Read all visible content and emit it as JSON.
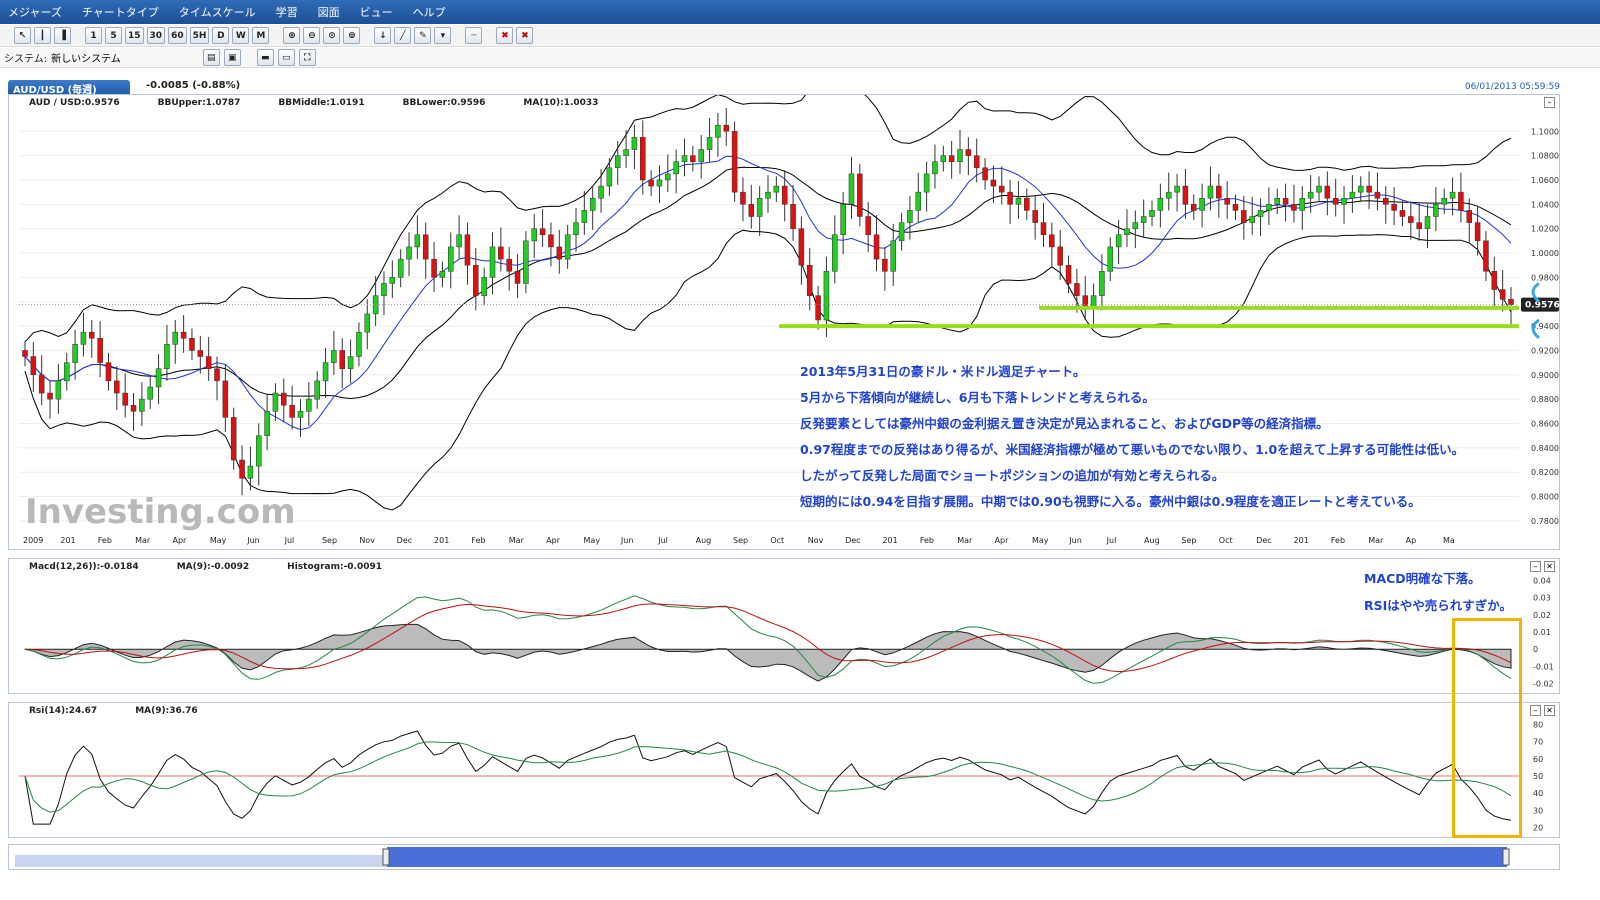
{
  "menu": {
    "items": [
      "メジャーズ",
      "チャートタイプ",
      "タイムスケール",
      "学習",
      "図面",
      "ビュー",
      "ヘルプ"
    ]
  },
  "toolbar": {
    "timeframes": [
      "1",
      "5",
      "15",
      "30",
      "60",
      "5H",
      "D",
      "W",
      "M"
    ]
  },
  "system": {
    "label": "システム:",
    "value": "新しいシステム"
  },
  "symbol": {
    "name": "AUD/USD (毎週)",
    "change": "-0.0085 (-0.88%)",
    "datetime": "06/01/2013 05:59:59"
  },
  "main_legend": {
    "price": "AUD / USD:0.9576",
    "bb_upper": "BBUpper:1.0787",
    "bb_middle": "BBMiddle:1.0191",
    "bb_lower": "BBLower:0.9596",
    "ma": "MA(10):1.0033"
  },
  "macd_legend": {
    "macd": "Macd(12,26)):-0.0184",
    "ma": "MA(9):-0.0092",
    "hist": "Histogram:-0.0091"
  },
  "rsi_legend": {
    "rsi": "Rsi(14):24.67",
    "ma": "MA(9):36.76"
  },
  "last_price": "0.9576",
  "watermark": "Investing.com",
  "annotations": {
    "main": [
      "2013年5月31日の豪ドル・米ドル週足チャート。",
      "5月から下落傾向が継続し、6月も下落トレンドと考えられる。",
      "反発要素としては豪州中銀の金利据え置き決定が見込まれること、およびGDP等の経済指標。",
      "0.97程度までの反発はあり得るが、米国経済指標が極めて悪いものでない限り、1.0を超えて上昇する可能性は低い。",
      "したがって反発した局面でショートポジションの追加が有効と考えられる。",
      "短期的には0.94を目指す展開。中期では0.90も視野に入る。豪州中銀は0.9程度を適正レートと考えている。"
    ],
    "macd": "MACD明確な下落。",
    "rsi": "RSIはやや売られすぎか。"
  },
  "colors": {
    "bull": "#22cc22",
    "bear": "#dd1111",
    "band": "#000000",
    "ma": "#2233dd",
    "macd_line": "#228844",
    "signal_line": "#bb1111",
    "hist": "#999999",
    "annotation": "#2244cc",
    "support": "#99dd22",
    "highlight": "#f5b400"
  },
  "chart_data": [
    {
      "type": "line",
      "subtype": "candlestick",
      "title": "AUD/USD (毎週)",
      "x_tick_labels": [
        "2009",
        "201",
        "Feb",
        "Mar",
        "Apr",
        "May",
        "Jun",
        "Jul",
        "Sep",
        "Nov",
        "Dec",
        "201",
        "Feb",
        "Mar",
        "Apr",
        "May",
        "Jun",
        "Jul",
        "Aug",
        "Sep",
        "Oct",
        "Nov",
        "Dec",
        "201",
        "Feb",
        "Mar",
        "Apr",
        "May",
        "Jun",
        "Jul",
        "Aug",
        "Sep",
        "Oct",
        "Dec",
        "201",
        "Feb",
        "Mar",
        "Ap",
        "Ma"
      ],
      "y_ticks": [
        0.78,
        0.8,
        0.82,
        0.84,
        0.86,
        0.88,
        0.9,
        0.92,
        0.94,
        0.96,
        0.98,
        1.0,
        1.02,
        1.04,
        1.06,
        1.08,
        1.1
      ],
      "ylim": [
        0.775,
        1.115
      ],
      "close_series": [
        0.915,
        0.9,
        0.885,
        0.88,
        0.895,
        0.91,
        0.925,
        0.935,
        0.93,
        0.91,
        0.895,
        0.885,
        0.875,
        0.87,
        0.88,
        0.89,
        0.905,
        0.925,
        0.935,
        0.93,
        0.92,
        0.915,
        0.905,
        0.895,
        0.865,
        0.83,
        0.815,
        0.825,
        0.85,
        0.87,
        0.885,
        0.875,
        0.865,
        0.87,
        0.88,
        0.895,
        0.91,
        0.92,
        0.905,
        0.915,
        0.935,
        0.95,
        0.965,
        0.975,
        0.98,
        0.995,
        1.005,
        1.015,
        0.995,
        0.98,
        0.985,
        1.005,
        1.015,
        0.99,
        0.965,
        0.98,
        1.005,
        0.995,
        0.985,
        0.975,
        1.01,
        1.02,
        1.015,
        1.005,
        0.995,
        1.015,
        1.025,
        1.035,
        1.045,
        1.055,
        1.07,
        1.08,
        1.085,
        1.095,
        1.06,
        1.055,
        1.06,
        1.065,
        1.075,
        1.08,
        1.075,
        1.085,
        1.095,
        1.105,
        1.1,
        1.05,
        1.04,
        1.03,
        1.045,
        1.05,
        1.055,
        1.04,
        1.02,
        0.99,
        0.965,
        0.945,
        0.985,
        1.015,
        1.04,
        1.065,
        1.03,
        1.015,
        0.995,
        0.985,
        1.01,
        1.025,
        1.035,
        1.05,
        1.065,
        1.075,
        1.08,
        1.075,
        1.085,
        1.08,
        1.07,
        1.06,
        1.055,
        1.05,
        1.04,
        1.045,
        1.035,
        1.025,
        1.015,
        1.005,
        0.99,
        0.975,
        0.965,
        0.955,
        0.965,
        0.985,
        1.005,
        1.015,
        1.02,
        1.025,
        1.03,
        1.035,
        1.045,
        1.05,
        1.055,
        1.04,
        1.035,
        1.045,
        1.055,
        1.045,
        1.04,
        1.035,
        1.025,
        1.03,
        1.035,
        1.04,
        1.045,
        1.04,
        1.035,
        1.045,
        1.05,
        1.055,
        1.045,
        1.04,
        1.045,
        1.05,
        1.055,
        1.05,
        1.045,
        1.04,
        1.035,
        1.03,
        1.025,
        1.02,
        1.03,
        1.04,
        1.045,
        1.05,
        1.035,
        1.025,
        1.01,
        0.985,
        0.97,
        0.962,
        0.9576
      ]
    },
    {
      "type": "line",
      "title": "MACD",
      "y_ticks": [
        -0.02,
        -0.01,
        0,
        0.01,
        0.02,
        0.03,
        0.04
      ],
      "ylim": [
        -0.022,
        0.042
      ],
      "series": [
        "Macd(12,26)",
        "MA(9)",
        "Histogram"
      ]
    },
    {
      "type": "line",
      "title": "RSI",
      "y_ticks": [
        20,
        30,
        40,
        50,
        60,
        70,
        80
      ],
      "ylim": [
        18,
        82
      ],
      "series": [
        "Rsi(14)",
        "MA(9)"
      ]
    }
  ]
}
